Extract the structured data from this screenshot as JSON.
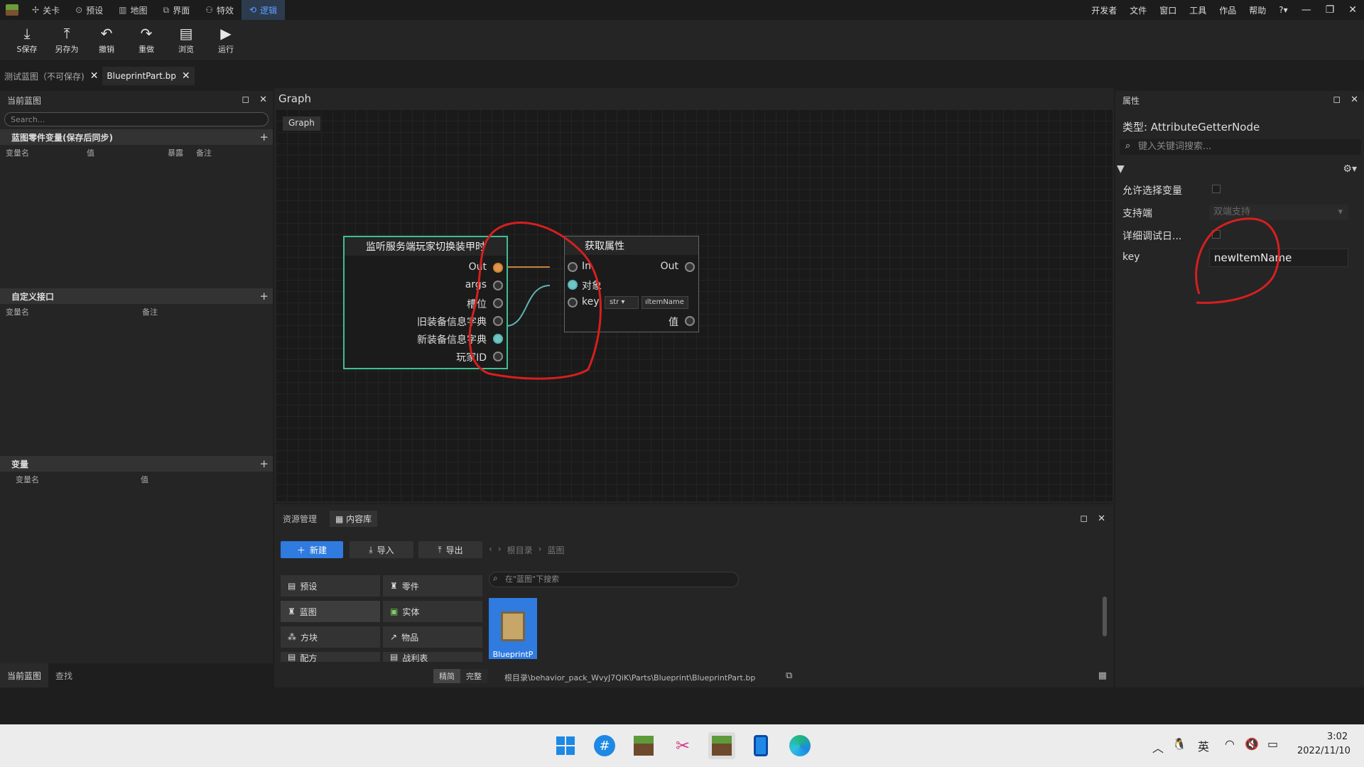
{
  "menubar": {
    "tabs": [
      {
        "icon": "✢",
        "label": "关卡"
      },
      {
        "icon": "⊙",
        "label": "预设"
      },
      {
        "icon": "▥",
        "label": "地图"
      },
      {
        "icon": "⧉",
        "label": "界面"
      },
      {
        "icon": "⚇",
        "label": "特效"
      },
      {
        "icon": "⟲",
        "label": "逻辑"
      }
    ],
    "right_items": [
      "开发者",
      "文件",
      "窗口",
      "工具",
      "作品",
      "帮助"
    ],
    "help_icon": "?▾",
    "window_controls": [
      "—",
      "❐",
      "✕"
    ]
  },
  "toolbar": {
    "buttons": [
      {
        "icon": "⤓",
        "label": "S保存"
      },
      {
        "icon": "⤒",
        "label": "另存为"
      },
      {
        "icon": "↶",
        "label": "撤销"
      },
      {
        "icon": "↷",
        "label": "重做"
      },
      {
        "icon": "▤",
        "label": "浏览"
      },
      {
        "icon": "▶",
        "label": "运行"
      }
    ]
  },
  "doc_tabs": [
    {
      "label": "测试蓝图（不可保存)"
    },
    {
      "label": "BlueprintPart.bp"
    }
  ],
  "left_panel": {
    "title": "当前蓝图",
    "search_placeholder": "Search...",
    "section1": {
      "title": "蓝图零件变量(保存后同步)",
      "cols": [
        "变量名",
        "值",
        "暴露",
        "备注"
      ]
    },
    "section2": {
      "title": "自定义接口",
      "cols": [
        "变量名",
        "备注"
      ]
    },
    "section3": {
      "title": "变量",
      "cols": [
        "变量名",
        "值"
      ]
    },
    "bottom_tabs": [
      "当前蓝图",
      "查找"
    ]
  },
  "graph": {
    "title": "Graph",
    "breadcrumb": "Graph",
    "event_node": {
      "title": "监听服务端玩家切换装甲时",
      "pins": [
        "Out",
        "args",
        "槽位",
        "旧装备信息字典",
        "新装备信息字典",
        "玩家ID"
      ]
    },
    "getter_node": {
      "title": "获取属性",
      "in_label": "In",
      "out_label": "Out",
      "target_label": "对象",
      "key_label": "key",
      "key_type": "str",
      "key_value": "ıltemName",
      "value_label": "值"
    }
  },
  "bottom_panel": {
    "tabs": [
      "资源管理",
      "内容库"
    ],
    "new_label": "新建",
    "import_label": "导入",
    "export_label": "导出",
    "breadcrumb_root": "根目录",
    "breadcrumb_current": "蓝图",
    "search_placeholder": "在\"蓝图\"下搜索",
    "categories": [
      {
        "icon": "▤",
        "label": "预设"
      },
      {
        "icon": "♜",
        "label": "零件"
      },
      {
        "icon": "♜",
        "label": "蓝图"
      },
      {
        "icon": "▣",
        "label": "实体"
      },
      {
        "icon": "⁂",
        "label": "方块"
      },
      {
        "icon": "↗",
        "label": "物品"
      },
      {
        "icon": "▤",
        "label": "配方"
      },
      {
        "icon": "▤",
        "label": "战利表"
      }
    ],
    "file_label": "BlueprintP",
    "mode_simple": "精简",
    "mode_full": "完整",
    "path": "根目录\\behavior_pack_WvyJ7QiK\\Parts\\Blueprint\\BlueprintPart.bp"
  },
  "right_panel": {
    "title": "属性",
    "type_label": "类型:",
    "type_value": "AttributeGetterNode",
    "search_placeholder": "键入关键词搜索...",
    "rows": {
      "allow_select": "允许选择变量",
      "support_side": "支持端",
      "support_side_value": "双端支持",
      "debug_log": "详细调试日...",
      "key_label": "key",
      "key_value": "newItemName"
    }
  },
  "taskbar": {
    "icons": [
      "start-icon",
      "hashtag-app-icon",
      "minecraft-icon",
      "snipping-icon",
      "minecraft-studio-icon",
      "phone-icon",
      "edge-icon"
    ],
    "ime": "英",
    "time": "3:02",
    "date": "2022/11/10"
  },
  "colors": {
    "accent": "#2f7be0",
    "node_border": "#3fbf8f",
    "annotation": "#d61f1f"
  }
}
